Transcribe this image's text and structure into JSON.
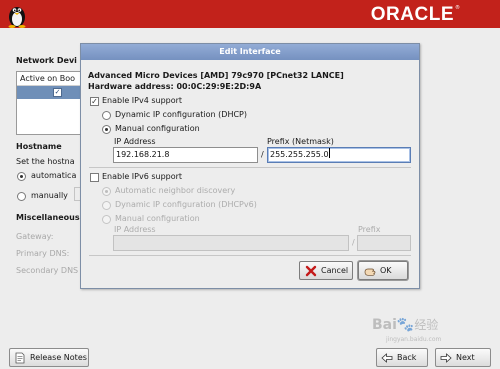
{
  "banner": {
    "logo_text": "ORACLE",
    "registered_mark": "®"
  },
  "background": {
    "network_devices_heading": "Network Devi",
    "device_list_header": "Active on Boo",
    "hostname_heading": "Hostname",
    "set_hostname_label": "Set the hostna",
    "automatic_label": "automatica",
    "manually_label": "manually",
    "misc_heading": "Miscellaneous",
    "gateway_label": "Gateway:",
    "primary_dns_label": "Primary DNS:",
    "secondary_dns_label": "Secondary DNS"
  },
  "dialog": {
    "title": "Edit Interface",
    "device_name": "Advanced Micro Devices [AMD] 79c970 [PCnet32 LANCE]",
    "hardware_address": "Hardware address: 00:0C:29:9E:2D:9A",
    "ipv4": {
      "enable_label": "Enable IPv4 support",
      "enabled": true,
      "dhcp_label": "Dynamic IP configuration (DHCP)",
      "manual_label": "Manual configuration",
      "selected": "manual",
      "ip_label": "IP Address",
      "ip_value": "192.168.21.8",
      "prefix_label": "Prefix (Netmask)",
      "prefix_value": "255.255.255.0",
      "separator": "/"
    },
    "ipv6": {
      "enable_label": "Enable IPv6 support",
      "enabled": false,
      "auto_label": "Automatic neighbor discovery",
      "dhcpv6_label": "Dynamic IP configuration (DHCPv6)",
      "manual_label": "Manual configuration",
      "ip_label": "IP Address",
      "prefix_label": "Prefix",
      "separator": "/"
    },
    "cancel_label": "Cancel",
    "ok_label": "OK"
  },
  "footer": {
    "release_notes_label": "Release Notes",
    "back_label": "Back",
    "next_label": "Next"
  },
  "watermark": {
    "brand": "Bai",
    "brand2": "经验",
    "url": "jingyan.baidu.com"
  },
  "colors": {
    "banner_red": "#c2221b",
    "dialog_title_blue": "#7f9acb",
    "selection_blue": "#6f8fb8"
  }
}
